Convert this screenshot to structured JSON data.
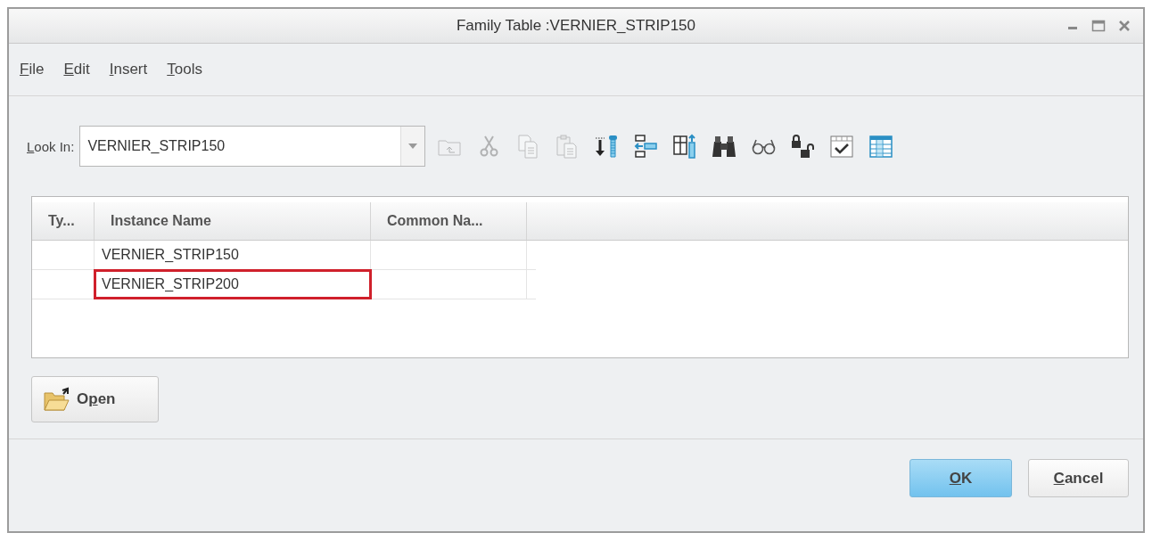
{
  "window": {
    "title": "Family Table :VERNIER_STRIP150"
  },
  "menu": [
    {
      "label": {
        "key": "F",
        "post": "ile"
      }
    },
    {
      "label": {
        "key": "E",
        "post": "dit"
      }
    },
    {
      "label": {
        "key": "I",
        "post": "nsert"
      }
    },
    {
      "label": {
        "key": "T",
        "post": "ools"
      }
    }
  ],
  "look_in": {
    "label": {
      "key": "L",
      "post": "ook In:"
    },
    "value": "VERNIER_STRIP150"
  },
  "toolbar": [
    {
      "kind": "folder-up",
      "disabled": true
    },
    {
      "kind": "cut",
      "disabled": true
    },
    {
      "kind": "copy",
      "disabled": true
    },
    {
      "kind": "paste",
      "disabled": true
    },
    {
      "kind": "screw",
      "disabled": false
    },
    {
      "kind": "insert-rows",
      "disabled": false
    },
    {
      "kind": "insert-column",
      "disabled": false
    },
    {
      "kind": "binoculars",
      "disabled": false
    },
    {
      "kind": "glasses",
      "disabled": false
    },
    {
      "kind": "locks",
      "disabled": false
    },
    {
      "kind": "verify",
      "disabled": false
    },
    {
      "kind": "table",
      "disabled": false
    }
  ],
  "table": {
    "columns": [
      "Ty...",
      "Instance Name",
      "Common Na..."
    ],
    "rows": [
      {
        "cells": [
          "",
          "VERNIER_STRIP150",
          ""
        ],
        "highlighted": false
      },
      {
        "cells": [
          "",
          "VERNIER_STRIP200",
          ""
        ],
        "highlighted": true
      }
    ]
  },
  "open_button": {
    "label": {
      "pre": "O",
      "key": "p",
      "post": "en"
    }
  },
  "buttons": [
    {
      "label": {
        "key": "O",
        "post": "K"
      },
      "kind": "primary"
    },
    {
      "label": {
        "key": "C",
        "post": "ancel"
      },
      "kind": "normal"
    }
  ]
}
